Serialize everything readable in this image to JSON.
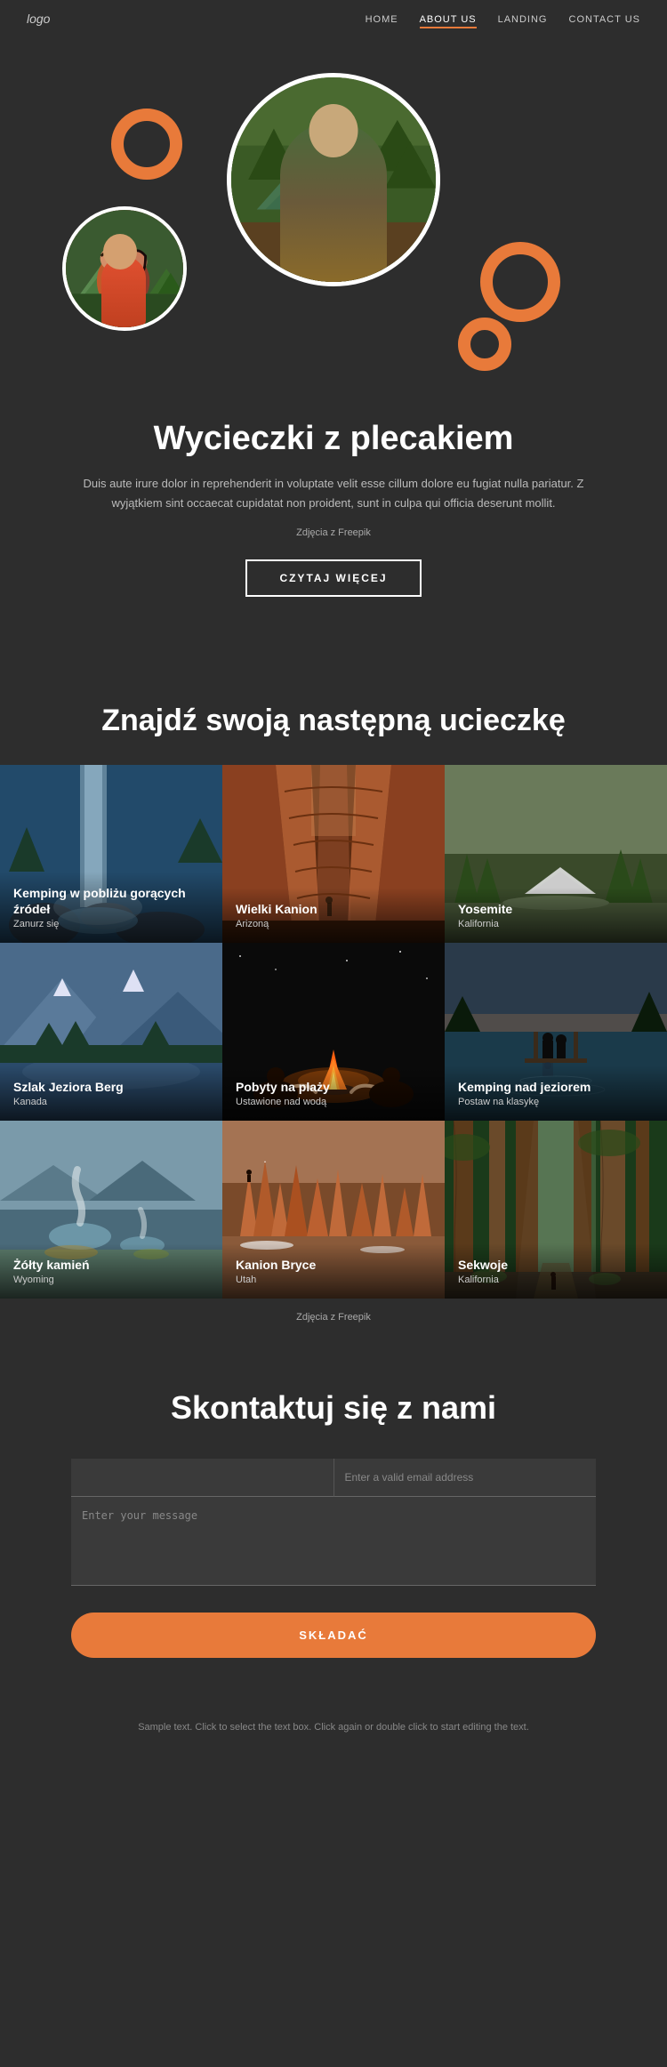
{
  "nav": {
    "logo": "logo",
    "links": [
      {
        "label": "HOME",
        "active": false
      },
      {
        "label": "ABOUT US",
        "active": true
      },
      {
        "label": "LANDING",
        "active": false
      },
      {
        "label": "CONTACT US",
        "active": false
      }
    ]
  },
  "hero": {
    "title": "Wycieczki z plecakiem",
    "description": "Duis aute irure dolor in reprehenderit in voluptate velit esse cillum dolore eu fugiat nulla pariatur. Z wyjątkiem sint occaecat cupidatat non proident, sunt in culpa qui officia deserunt mollit.",
    "freepik_text": "Zdjęcia z Freepik",
    "read_more_btn": "CZYTAJ WIĘCEJ"
  },
  "section_find": {
    "title": "Znajdź swoją następną ucieczkę",
    "grid_items": [
      {
        "label": "Kemping w pobliżu gorących źródeł",
        "sublabel": "Zanurz się",
        "bg": "waterfall"
      },
      {
        "label": "Wielki Kanion",
        "sublabel": "Arizoną",
        "bg": "canyon-red"
      },
      {
        "label": "Yosemite",
        "sublabel": "Kalifornia",
        "bg": "yosemite"
      },
      {
        "label": "Szlak Jeziora Berg",
        "sublabel": "Kanada",
        "bg": "mountains"
      },
      {
        "label": "Pobyty na plaży",
        "sublabel": "Ustawione nad wodą",
        "bg": "campfire"
      },
      {
        "label": "Kemping nad jeziorem",
        "sublabel": "Postaw na klasykę",
        "bg": "lake"
      },
      {
        "label": "Żółty kamień",
        "sublabel": "Wyoming",
        "bg": "yellow-stone"
      },
      {
        "label": "Kanion Bryce",
        "sublabel": "Utah",
        "bg": "bryce"
      },
      {
        "label": "Sekwoje",
        "sublabel": "Kalifornia",
        "bg": "sequoia"
      }
    ],
    "freepik_text": "Zdjęcia z Freepik"
  },
  "contact": {
    "title": "Skontaktuj się z nami",
    "name_placeholder": "",
    "email_placeholder": "Enter a valid email address",
    "message_placeholder": "Enter your message",
    "submit_btn": "SKŁADAĆ"
  },
  "footer": {
    "text": "Sample text. Click to select the text box. Click again or double click to start editing the text."
  },
  "colors": {
    "accent": "#e87a3a",
    "bg": "#2d2d2d",
    "text_primary": "#ffffff",
    "text_secondary": "#bbbbbb"
  }
}
